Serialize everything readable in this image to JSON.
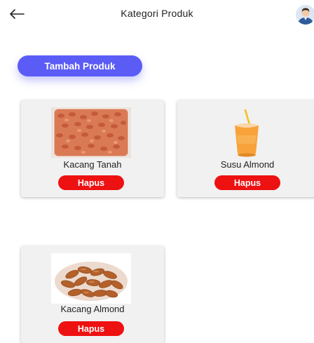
{
  "header": {
    "title": "Kategori Produk"
  },
  "actions": {
    "add_label": "Tambah Produk"
  },
  "products": [
    {
      "name": "Kacang Tanah",
      "delete_label": "Hapus"
    },
    {
      "name": "Susu Almond",
      "delete_label": "Hapus"
    },
    {
      "name": "Kacang Almond",
      "delete_label": "Hapus"
    }
  ],
  "colors": {
    "accent": "#5b5cf6",
    "danger": "#ee1111",
    "card_bg": "#f1f1f1"
  }
}
